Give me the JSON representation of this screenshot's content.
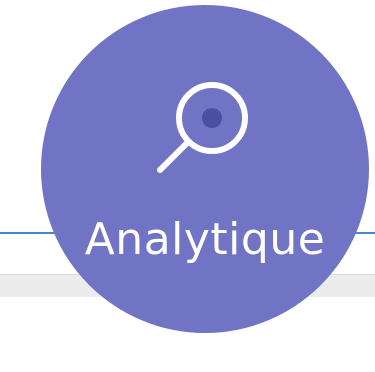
{
  "badge": {
    "label": "Analytique",
    "icon": "magnifier-icon",
    "circle_color": "#7174c4",
    "icon_color": "#ffffff",
    "icon_dot_color": "#4b50a4"
  },
  "accent_line_color": "#4a86c8",
  "bar_color": "#ececec"
}
